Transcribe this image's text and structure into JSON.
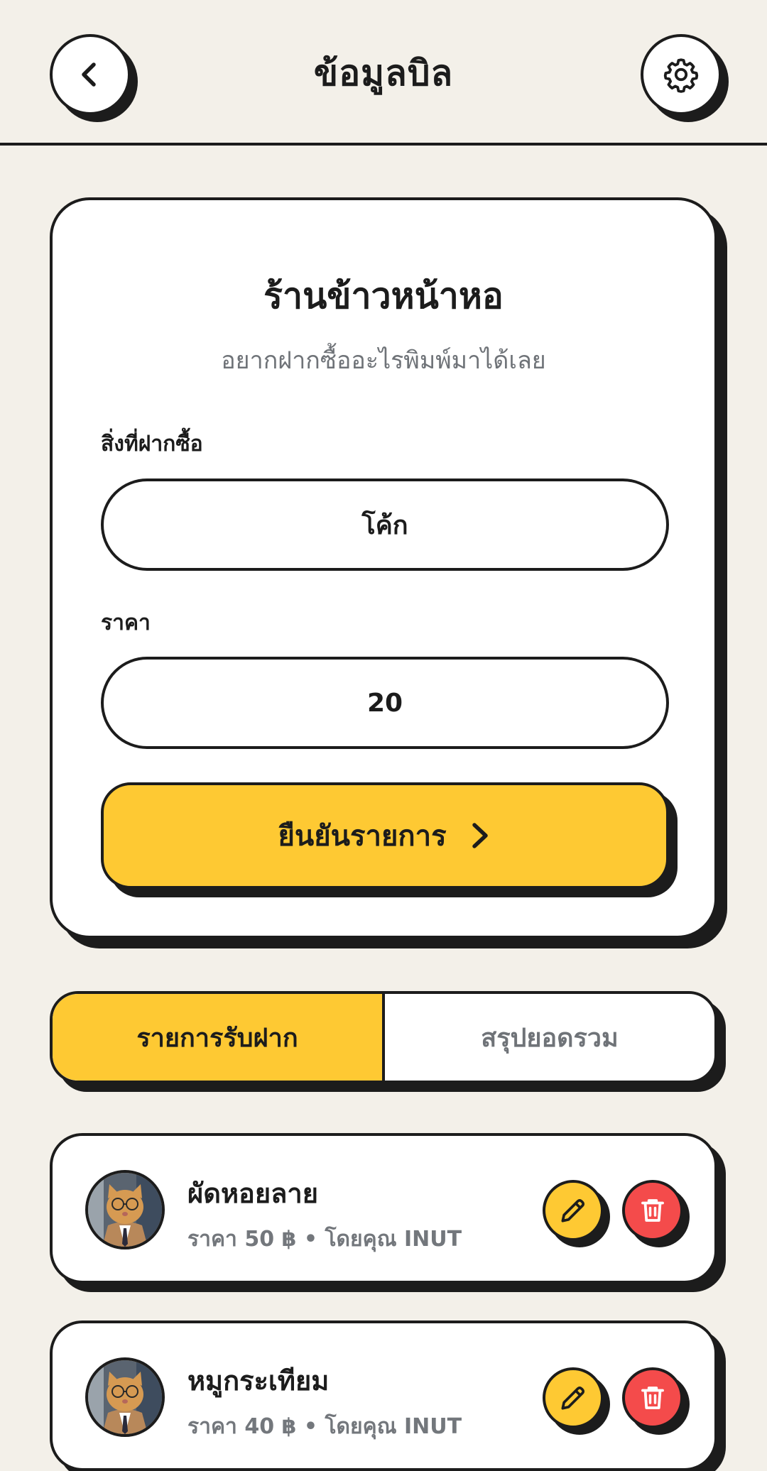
{
  "header": {
    "title": "ข้อมูลบิล",
    "back_icon": "chevron-left-icon",
    "settings_icon": "gear-icon"
  },
  "form": {
    "shop_name": "ร้านข้าวหน้าหอ",
    "hint": "อยากฝากซื้ออะไรพิมพ์มาได้เลย",
    "item_label": "สิ่งที่ฝากซื้อ",
    "item_value": "โค้ก",
    "price_label": "ราคา",
    "price_value": "20",
    "confirm_label": "ยืนยันรายการ"
  },
  "tabs": [
    {
      "label": "รายการรับฝาก",
      "active": true
    },
    {
      "label": "สรุปยอดรวม",
      "active": false
    }
  ],
  "items": [
    {
      "name": "ผัดหอยลาย",
      "meta": "ราคา 50 ฿ • โดยคุณ INUT"
    },
    {
      "name": "หมูกระเทียม",
      "meta": "ราคา 40 ฿ • โดยคุณ INUT"
    }
  ],
  "colors": {
    "background": "#f3f0e9",
    "accent_yellow": "#fec933",
    "delete_red": "#f44b4b",
    "outline": "#1c1c1c",
    "muted_text": "#6f7378"
  }
}
